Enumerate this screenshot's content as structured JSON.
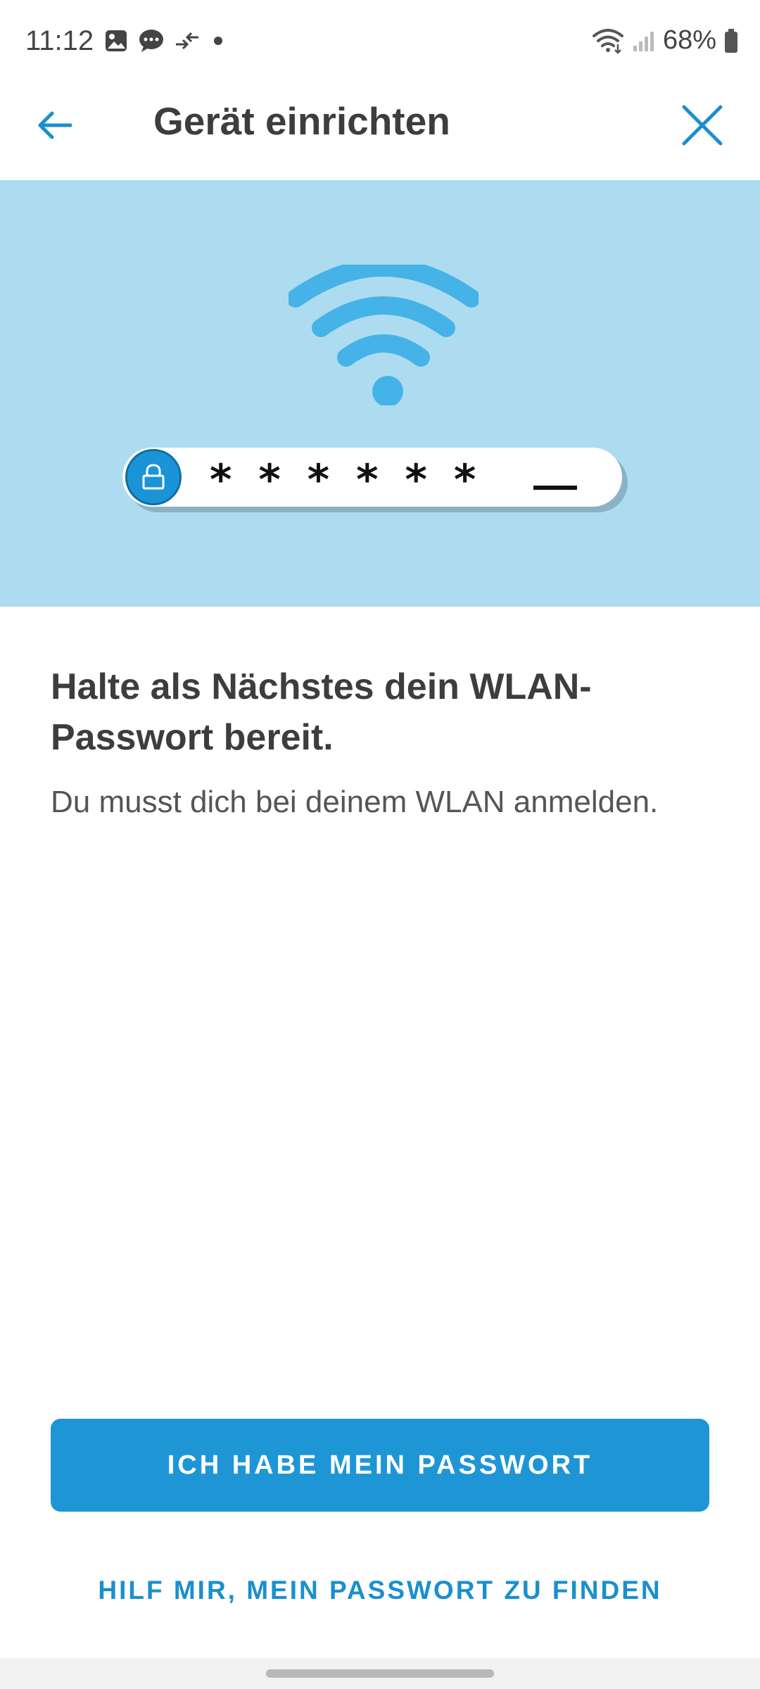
{
  "status_bar": {
    "time": "11:12",
    "battery": "68%",
    "icons": [
      "gallery-icon",
      "chat-icon",
      "data-transfer-icon",
      "dot-icon",
      "wifi-icon",
      "signal-icon",
      "battery-icon"
    ]
  },
  "app_bar": {
    "title": "Gerät einrichten",
    "back_icon": "arrow-left-icon",
    "close_icon": "close-icon"
  },
  "hero": {
    "masked_password": "******",
    "icons": [
      "wifi-icon",
      "lock-icon"
    ]
  },
  "content": {
    "heading": "Halte als Nächstes dein WLAN-Passwort bereit.",
    "body": "Du musst dich bei deinem WLAN anmelden."
  },
  "actions": {
    "primary_label": "ICH HABE MEIN PASSWORT",
    "secondary_label": "HILF MIR, MEIN PASSWORT ZU FINDEN"
  },
  "colors": {
    "accent": "#1e96d6",
    "hero_background": "#addcf0",
    "wifi_icon": "#45b3e7"
  }
}
